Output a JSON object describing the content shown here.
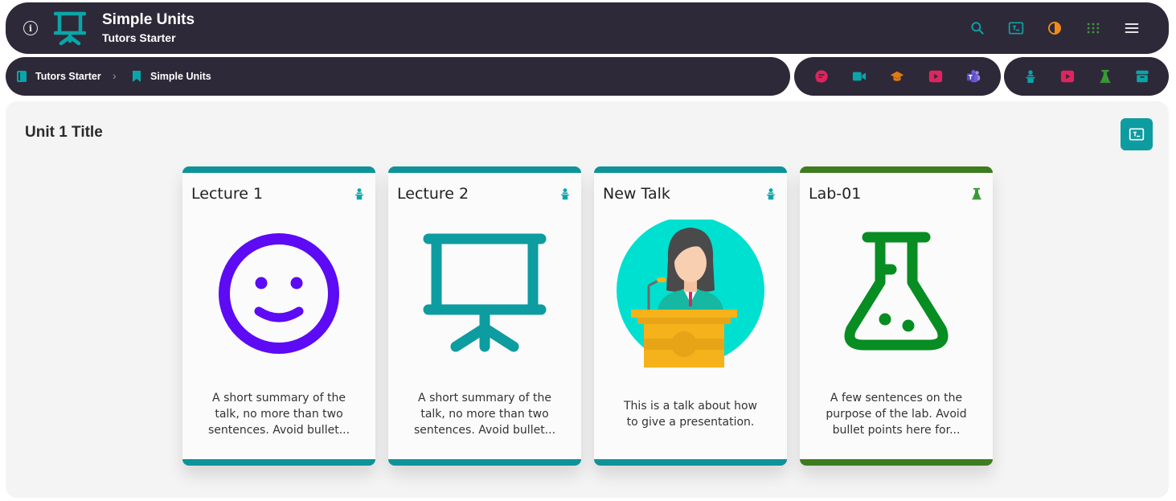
{
  "header": {
    "title": "Simple Units",
    "subtitle": "Tutors Starter",
    "info_icon": "info-icon",
    "logo_icon": "presentation-icon",
    "actions": [
      {
        "name": "search-icon",
        "color": "#0aa5a8"
      },
      {
        "name": "tutors-icon",
        "color": "#0aa5a8"
      },
      {
        "name": "theme-toggle-icon",
        "color": "#f08c1a"
      },
      {
        "name": "grid-apps-icon",
        "color": "#3a9a36"
      },
      {
        "name": "menu-icon",
        "color": "#ffffff"
      }
    ]
  },
  "breadcrumb": {
    "items": [
      {
        "label": "Tutors Starter",
        "icon": "book-icon",
        "color": "#0aa5a8"
      },
      {
        "label": "Simple Units",
        "icon": "bookmark-icon",
        "color": "#0aa5a8"
      }
    ],
    "separator": "›"
  },
  "companions": [
    {
      "name": "chat-icon",
      "color": "#e0245e"
    },
    {
      "name": "video-icon",
      "color": "#0aa5a8"
    },
    {
      "name": "moodle-icon",
      "color": "#e07b12"
    },
    {
      "name": "youtube-icon",
      "color": "#e0245e"
    },
    {
      "name": "teams-icon",
      "color": "#6f5bd6"
    }
  ],
  "wall_links": [
    {
      "name": "talks-icon",
      "color": "#0aa5a8"
    },
    {
      "name": "videos-icon",
      "color": "#e0245e"
    },
    {
      "name": "labs-icon",
      "color": "#3a9a36"
    },
    {
      "name": "archive-icon",
      "color": "#0aa5a8"
    }
  ],
  "unit": {
    "title": "Unit 1 Title",
    "action_icon": "tutors-icon"
  },
  "cards": [
    {
      "title": "Lecture 1",
      "type": "talk",
      "image": "smiley",
      "description": "A short summary of the talk, no more than two sentences. Avoid bullet..."
    },
    {
      "title": "Lecture 2",
      "type": "talk",
      "image": "presentation",
      "description": "A short summary of the talk, no more than two sentences. Avoid bullet..."
    },
    {
      "title": "New Talk",
      "type": "talk",
      "image": "speaker",
      "description": "This is a talk about how to give a presentation."
    },
    {
      "title": "Lab-01",
      "type": "lab",
      "image": "flask",
      "description": "A few sentences on the purpose of the lab. Avoid bullet points here for..."
    }
  ],
  "colors": {
    "bar_bg": "#2e2939",
    "talk_accent": "#0d9398",
    "lab_accent": "#3e7c1f",
    "smiley": "#5d0af5",
    "flask": "#078d22"
  }
}
